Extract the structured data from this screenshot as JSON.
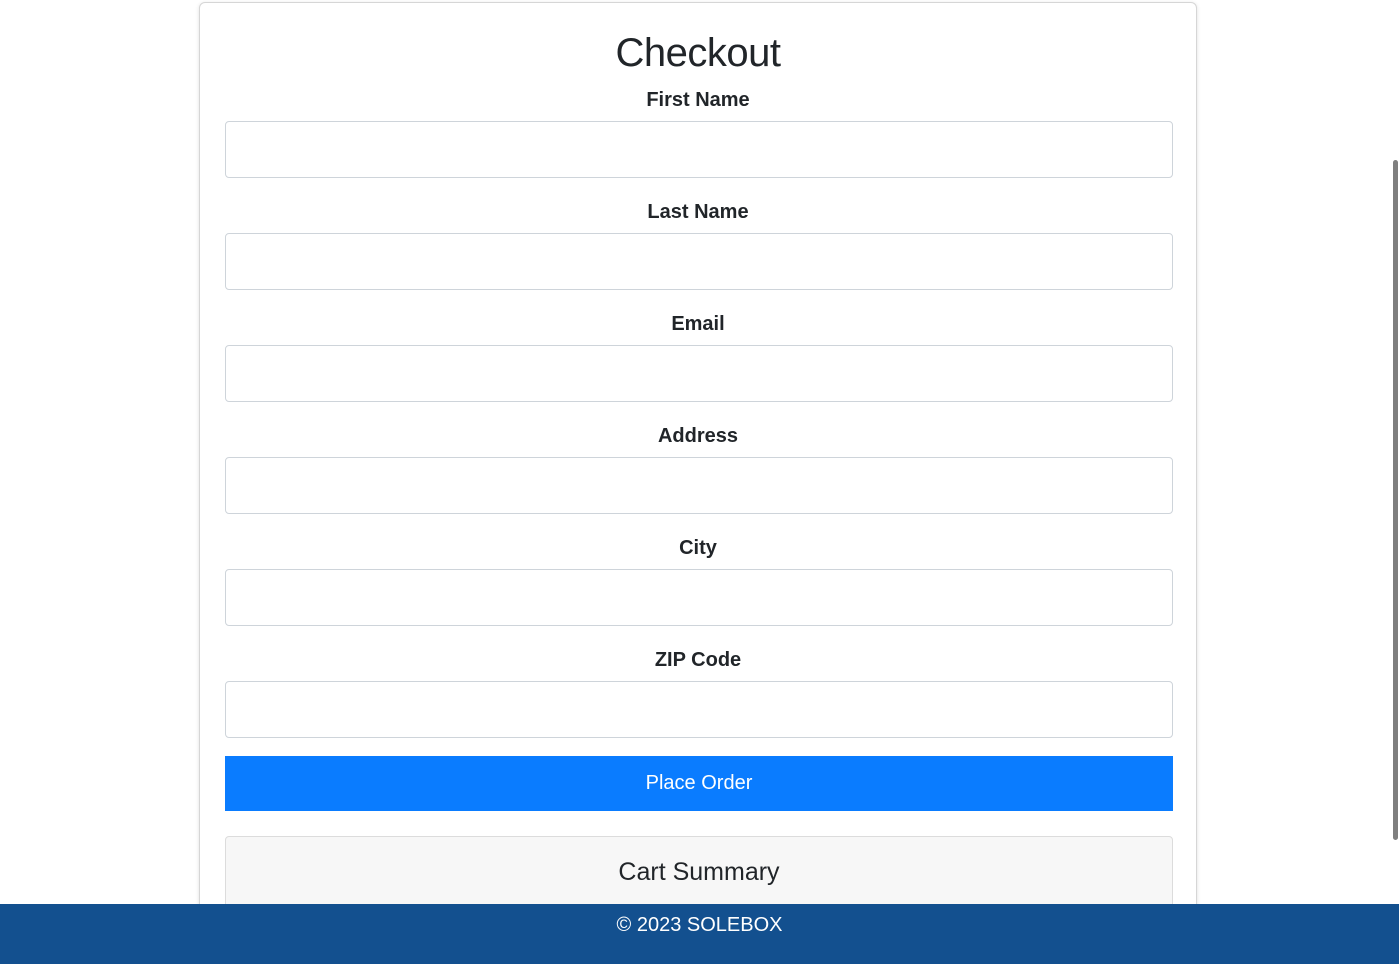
{
  "checkout": {
    "title": "Checkout",
    "fields": [
      {
        "label": "First Name",
        "value": "",
        "placeholder": ""
      },
      {
        "label": "Last Name",
        "value": "",
        "placeholder": ""
      },
      {
        "label": "Email",
        "value": "",
        "placeholder": ""
      },
      {
        "label": "Address",
        "value": "",
        "placeholder": ""
      },
      {
        "label": "City",
        "value": "",
        "placeholder": ""
      },
      {
        "label": "ZIP Code",
        "value": "",
        "placeholder": ""
      }
    ],
    "submit_label": "Place Order",
    "cart_summary_title": "Cart Summary"
  },
  "footer": {
    "text": "© 2023 SOLEBOX"
  },
  "colors": {
    "primary_button": "#0a7cff",
    "footer_background": "#13508f"
  }
}
